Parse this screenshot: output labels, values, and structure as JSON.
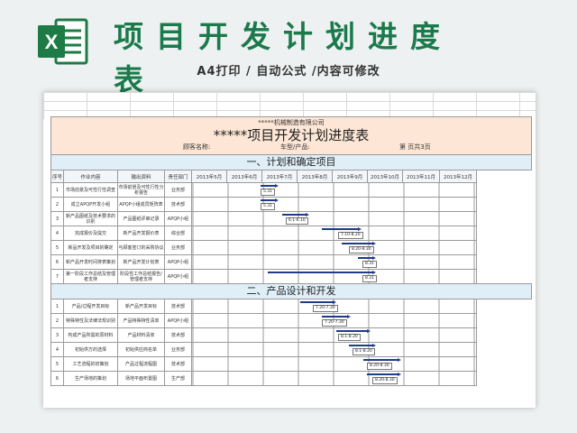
{
  "banner": {
    "title": "项目开发计划进度表",
    "subtitle": "A4打印 / 自动公式 /内容可修改",
    "logo_letter": "X",
    "logo_color": "#1e7b45"
  },
  "sheet": {
    "company": "*****机械制造有限公司",
    "title": "*****项目开发计划进度表",
    "customer_label": "顾客名称:",
    "model_label": "车型/产品:",
    "page_label": "第    页共3页",
    "columns": [
      "序号",
      "作业内容",
      "输出资料",
      "责任部门",
      "2013年5月",
      "2013年6月",
      "2013年7月",
      "2013年8月",
      "2013年9月",
      "2013年10月",
      "2013年11月",
      "2013年12月"
    ],
    "sections": [
      {
        "title": "一、计划和确定项目",
        "rows": [
          {
            "no": "1",
            "task": "市场前景及可性行性调查",
            "output": "市场前景及可性行性分析报告",
            "dept": "业务部",
            "label": "5.31"
          },
          {
            "no": "2",
            "task": "成立APQP开发小组",
            "output": "APQP小组成员矩阵表",
            "dept": "技术部",
            "label": "5.31"
          },
          {
            "no": "3",
            "task": "新产品图纸及技术要求的识别",
            "output": "产品图纸评审记录",
            "dept": "APQP小组",
            "label": "6.1-6.10"
          },
          {
            "no": "4",
            "task": "完成报价及提交",
            "output": "新产品开发报价表",
            "dept": "综合部",
            "label": "7.10-8.20"
          },
          {
            "no": "5",
            "task": "新品开发及项目的确定",
            "output": "与顾客签订的采购协议",
            "dept": "业务部",
            "label": "8.20-8.30"
          },
          {
            "no": "6",
            "task": "新产品开发时间排表策划",
            "output": "新产品开发计划表",
            "dept": "APQP小组",
            "label": "8.31"
          },
          {
            "no": "7",
            "task": "第一阶段工作总结及管理者支持",
            "output": "阶段性工作总结报告/管理者支持",
            "dept": "APQP小组",
            "label": "8.31"
          }
        ]
      },
      {
        "title": "二、产品设计和开发",
        "rows": [
          {
            "no": "1",
            "task": "产品/过程开发目标",
            "output": "新产品开发目标",
            "dept": "技术部",
            "label": "7.20-7.30"
          },
          {
            "no": "2",
            "task": "特殊特性及法律法规识别",
            "output": "产品特殊特性清单",
            "dept": "APQP小组",
            "label": "7.20-7.30"
          },
          {
            "no": "3",
            "task": "构成产品所需的原材料",
            "output": "产品材料清单",
            "dept": "技术部",
            "label": "8.1-8.20"
          },
          {
            "no": "4",
            "task": "初始供方的选择",
            "output": "初始供应商名单",
            "dept": "业务部",
            "label": "8.1-8.20"
          },
          {
            "no": "5",
            "task": "工艺流程的初策划",
            "output": "产品过程流程图",
            "dept": "技术部",
            "label": "8.20-8.30"
          },
          {
            "no": "6",
            "task": "生产场地的策划",
            "output": "场地平面布置图",
            "dept": "生产部",
            "label": "8.20-8.30"
          }
        ]
      }
    ]
  }
}
